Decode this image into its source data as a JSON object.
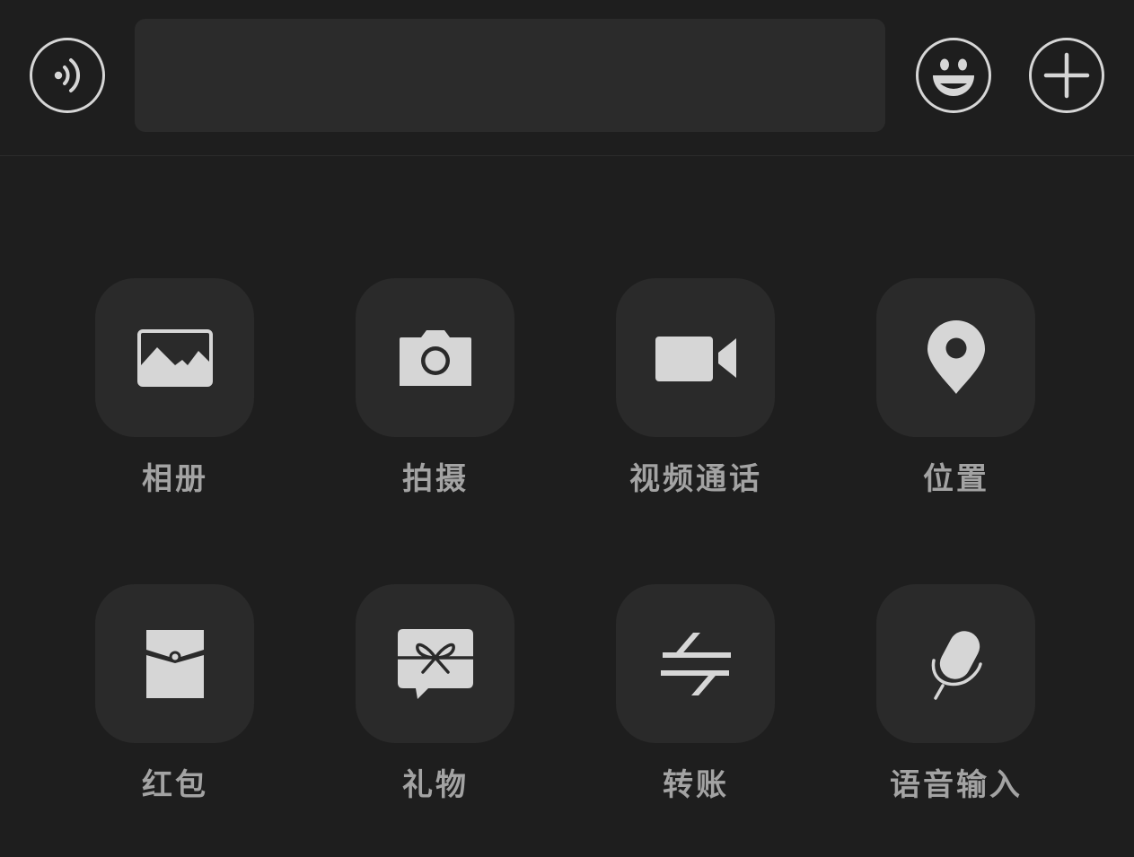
{
  "input_bar": {
    "voice_icon": "voice-wave-icon",
    "message_value": "",
    "emoji_icon": "smiley-icon",
    "more_icon": "plus-icon"
  },
  "tools": [
    {
      "label": "相册",
      "icon": "image-icon"
    },
    {
      "label": "拍摄",
      "icon": "camera-icon"
    },
    {
      "label": "视频通话",
      "icon": "video-camera-icon"
    },
    {
      "label": "位置",
      "icon": "location-pin-icon"
    },
    {
      "label": "红包",
      "icon": "red-packet-icon"
    },
    {
      "label": "礼物",
      "icon": "gift-icon"
    },
    {
      "label": "转账",
      "icon": "transfer-icon"
    },
    {
      "label": "语音输入",
      "icon": "microphone-icon"
    }
  ],
  "colors": {
    "background": "#1e1e1e",
    "tile": "#2a2a2a",
    "input_field": "#2b2b2b",
    "icon": "#d6d6d6",
    "label": "#a3a3a3"
  }
}
